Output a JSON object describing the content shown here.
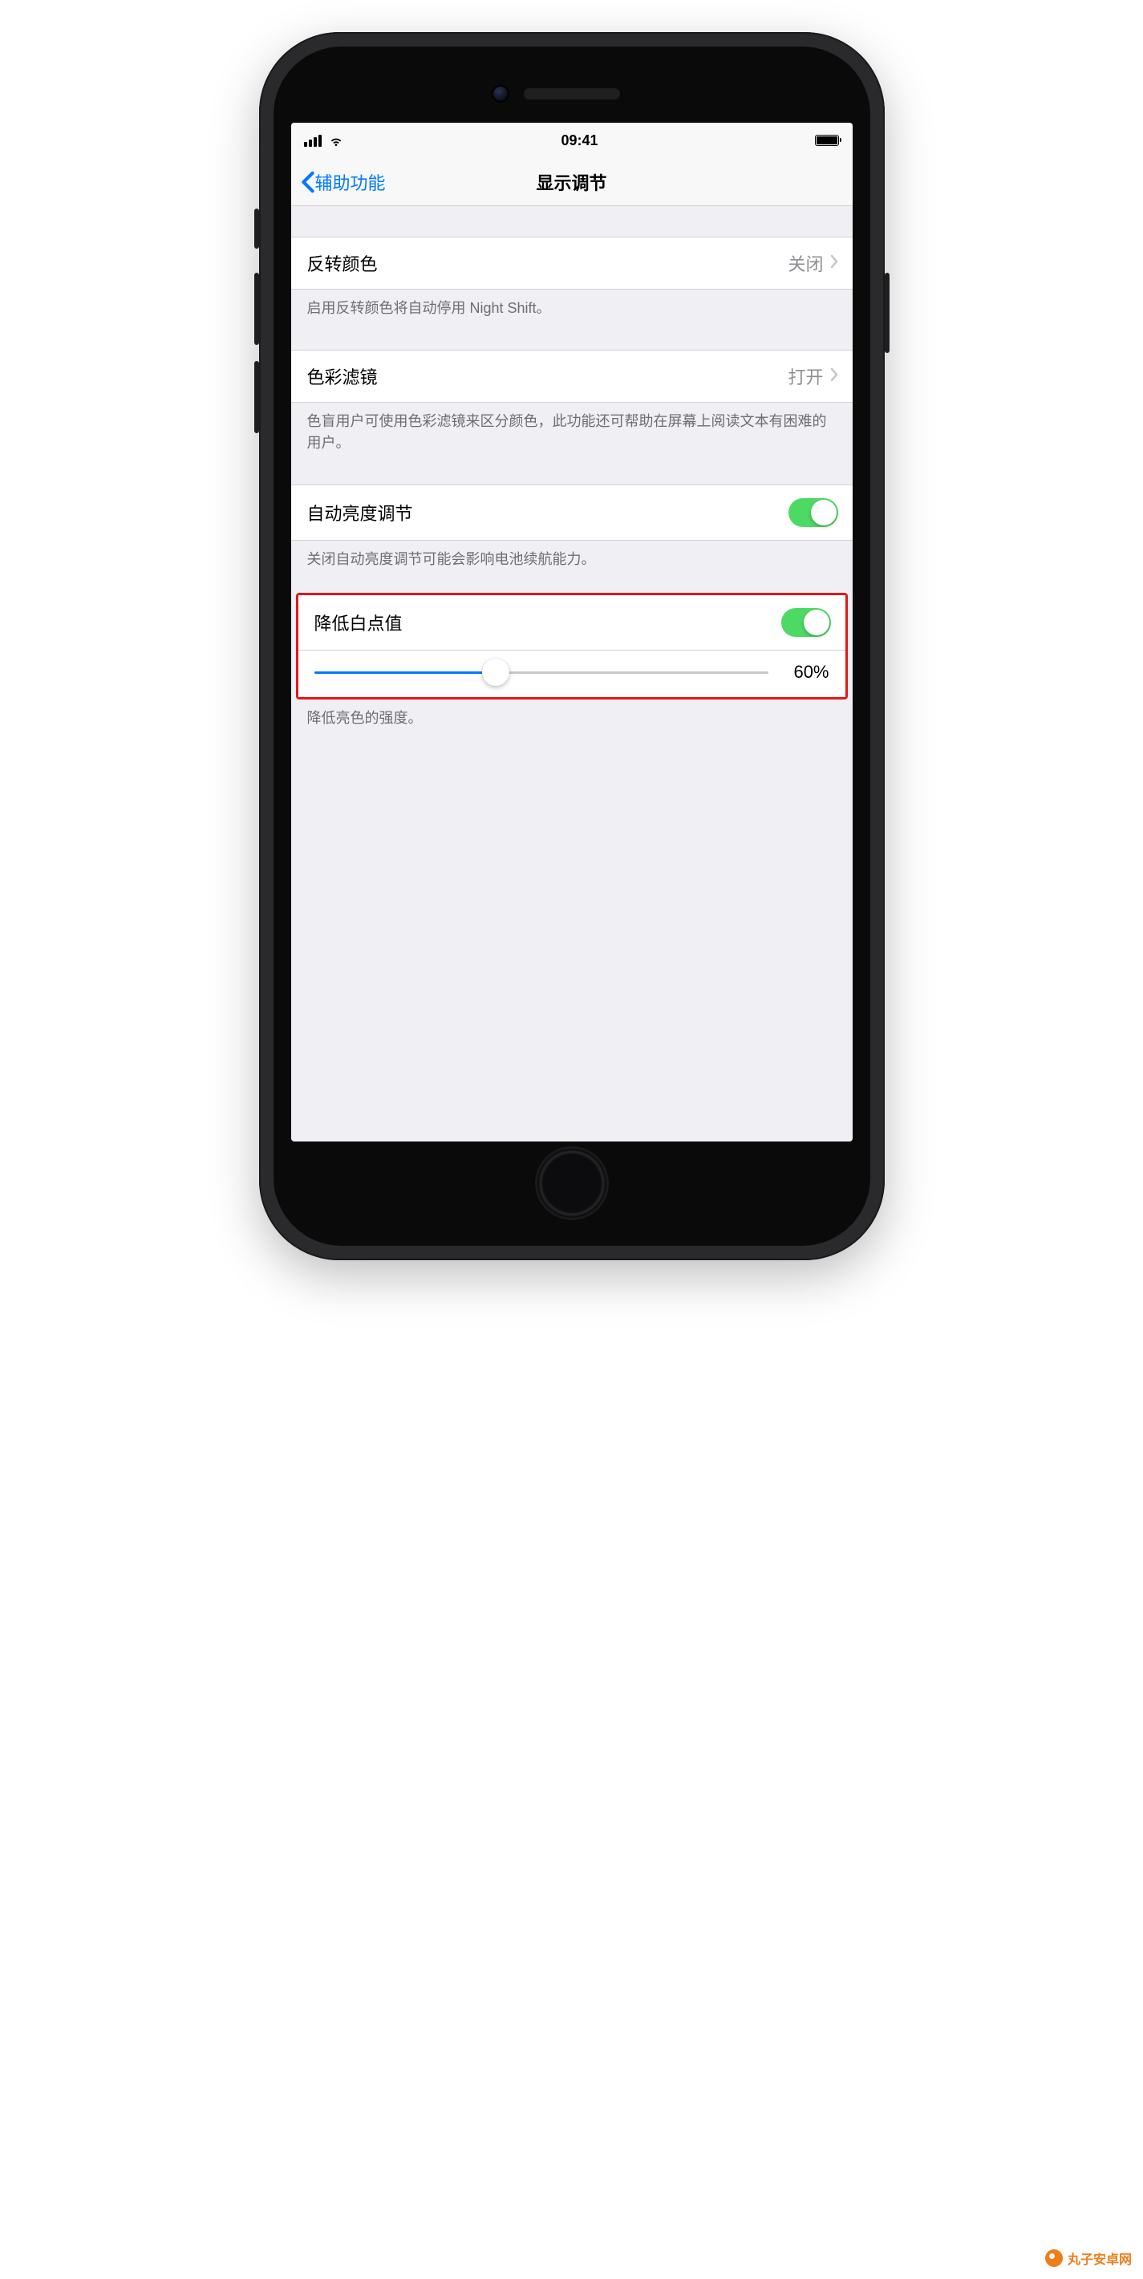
{
  "statusBar": {
    "time": "09:41"
  },
  "navBar": {
    "back": "辅助功能",
    "title": "显示调节"
  },
  "rows": {
    "invertColors": {
      "label": "反转颜色",
      "value": "关闭",
      "footer": "启用反转颜色将自动停用 Night Shift。"
    },
    "colorFilters": {
      "label": "色彩滤镜",
      "value": "打开",
      "footer": "色盲用户可使用色彩滤镜来区分颜色，此功能还可帮助在屏幕上阅读文本有困难的用户。"
    },
    "autoBrightness": {
      "label": "自动亮度调节",
      "on": true,
      "footer": "关闭自动亮度调节可能会影响电池续航能力。"
    },
    "reduceWhitePoint": {
      "label": "降低白点值",
      "on": true,
      "sliderPercent": 40,
      "sliderDisplay": "60%",
      "footer": "降低亮色的强度。"
    }
  },
  "watermark": "丸子安卓网"
}
